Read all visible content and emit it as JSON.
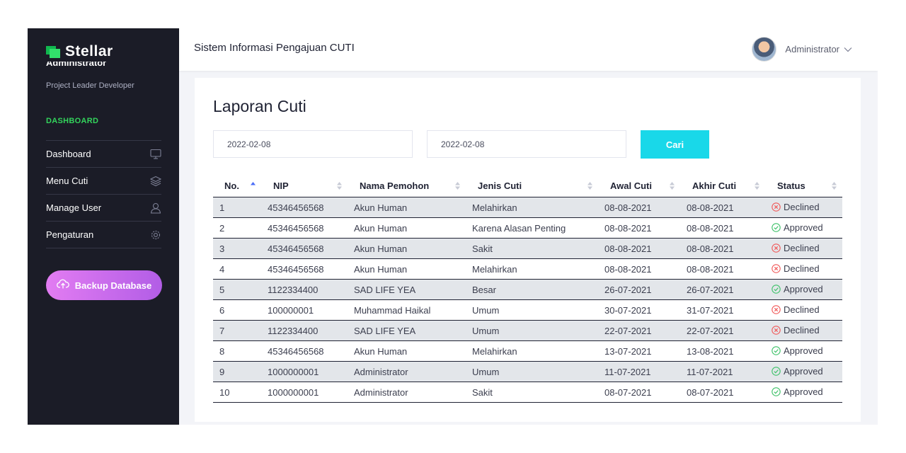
{
  "colors": {
    "sidebar_bg": "#1b1c27",
    "accent_green": "#33d45c",
    "button_cyan": "#19d8e9",
    "backup_gradient_start": "#e27cf2",
    "backup_gradient_end": "#b25de6",
    "declined_red": "#f15a5a",
    "approved_green": "#3fc26a",
    "row_alt": "#e3e6ea"
  },
  "sidebar": {
    "brand": "Stellar",
    "user_name": "Administrator",
    "user_role": "Project Leader Developer",
    "section_title": "DASHBOARD",
    "items": [
      {
        "label": "Dashboard",
        "icon": "monitor-icon"
      },
      {
        "label": "Menu Cuti",
        "icon": "layers-icon"
      },
      {
        "label": "Manage User",
        "icon": "user-icon"
      },
      {
        "label": "Pengaturan",
        "icon": "gear-icon"
      }
    ],
    "backup_button": {
      "label": "Backup Database",
      "icon": "cloud-upload-icon"
    }
  },
  "topbar": {
    "title": "Sistem Informasi Pengajuan CUTI",
    "user_name": "Administrator",
    "dropdown_icon": "chevron-down-icon"
  },
  "main": {
    "title": "Laporan Cuti",
    "date_from": "2022-02-08",
    "date_to": "2022-02-08",
    "search_label": "Cari",
    "table": {
      "columns": [
        "No.",
        "NIP",
        "Nama Pemohon",
        "Jenis Cuti",
        "Awal Cuti",
        "Akhir Cuti",
        "Status"
      ],
      "sorted_column": "No.",
      "sort_direction": "ascending",
      "rows": [
        {
          "no": "1",
          "nip": "45346456568",
          "nama": "Akun Human",
          "jenis": "Melahirkan",
          "awal": "08-08-2021",
          "akhir": "08-08-2021",
          "status": "Declined"
        },
        {
          "no": "2",
          "nip": "45346456568",
          "nama": "Akun Human",
          "jenis": "Karena Alasan Penting",
          "awal": "08-08-2021",
          "akhir": "08-08-2021",
          "status": "Approved"
        },
        {
          "no": "3",
          "nip": "45346456568",
          "nama": "Akun Human",
          "jenis": "Sakit",
          "awal": "08-08-2021",
          "akhir": "08-08-2021",
          "status": "Declined"
        },
        {
          "no": "4",
          "nip": "45346456568",
          "nama": "Akun Human",
          "jenis": "Melahirkan",
          "awal": "08-08-2021",
          "akhir": "08-08-2021",
          "status": "Declined"
        },
        {
          "no": "5",
          "nip": "1122334400",
          "nama": "SAD LIFE YEA",
          "jenis": "Besar",
          "awal": "26-07-2021",
          "akhir": "26-07-2021",
          "status": "Approved"
        },
        {
          "no": "6",
          "nip": "100000001",
          "nama": "Muhammad Haikal",
          "jenis": "Umum",
          "awal": "30-07-2021",
          "akhir": "31-07-2021",
          "status": "Declined"
        },
        {
          "no": "7",
          "nip": "1122334400",
          "nama": "SAD LIFE YEA",
          "jenis": "Umum",
          "awal": "22-07-2021",
          "akhir": "22-07-2021",
          "status": "Declined"
        },
        {
          "no": "8",
          "nip": "45346456568",
          "nama": "Akun Human",
          "jenis": "Melahirkan",
          "awal": "13-07-2021",
          "akhir": "13-08-2021",
          "status": "Approved"
        },
        {
          "no": "9",
          "nip": "1000000001",
          "nama": "Administrator",
          "jenis": "Umum",
          "awal": "11-07-2021",
          "akhir": "11-07-2021",
          "status": "Approved"
        },
        {
          "no": "10",
          "nip": "1000000001",
          "nama": "Administrator",
          "jenis": "Sakit",
          "awal": "08-07-2021",
          "akhir": "08-07-2021",
          "status": "Approved"
        }
      ]
    }
  }
}
